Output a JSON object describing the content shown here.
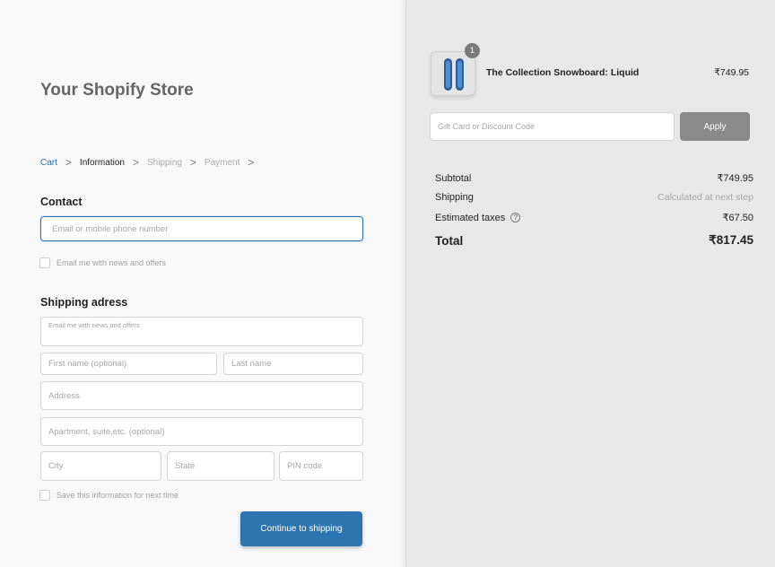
{
  "store": {
    "title": "Your Shopify Store"
  },
  "breadcrumb": {
    "cart": "Cart",
    "information": "Information",
    "shipping": "Shipping",
    "payment": "Payment",
    "separator": ">"
  },
  "contact": {
    "title": "Contact",
    "email_placeholder": "Email or mobile phone number",
    "newsletter_label": "Email me with news and offers"
  },
  "shipping_address": {
    "title": "Shipping adress",
    "floating_label": "Email me with news and offers",
    "first_name_placeholder": "First name (optional)",
    "last_name_placeholder": "Last name",
    "address_placeholder": "Address",
    "apartment_placeholder": "Apartment, suite,etc. (optional)",
    "city_placeholder": "City",
    "state_placeholder": "State",
    "pin_placeholder": "PIN code",
    "save_info_label": "Save this information for next time",
    "continue_label": "Continue to shipping"
  },
  "cart": {
    "product_name": "The Collection Snowboard: Liquid",
    "product_price": "₹749.95",
    "quantity": "1",
    "discount_placeholder": "Gift Card or Discount Code",
    "apply_label": "Apply"
  },
  "summary": {
    "subtotal_label": "Subtotal",
    "subtotal_value": "₹749.95",
    "shipping_label": "Shipping",
    "shipping_value": "Calculated at next step",
    "taxes_label": "Estimated taxes",
    "taxes_value": "₹67.50",
    "total_label": "Total",
    "total_value": "₹817.45"
  },
  "colors": {
    "accent": "#2c75b0",
    "link": "#2a6ebb",
    "apply_button": "#8a8a8a"
  }
}
